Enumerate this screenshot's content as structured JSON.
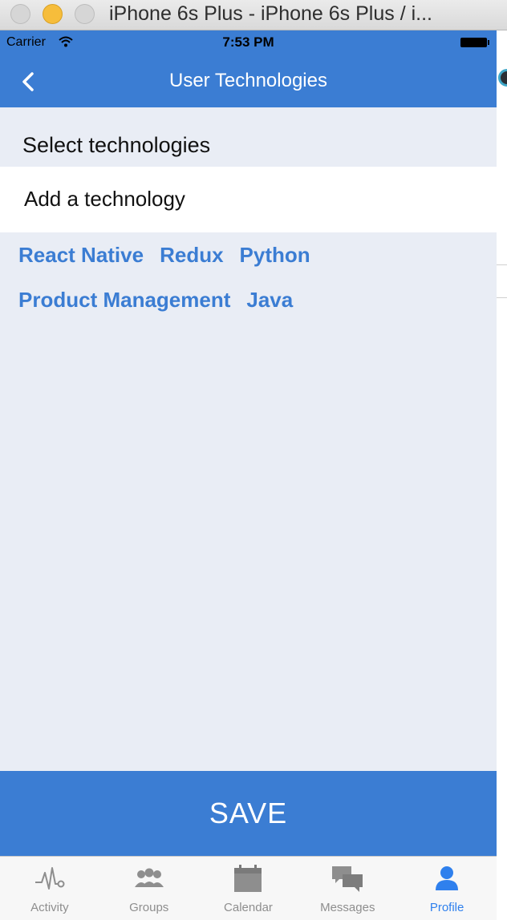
{
  "window": {
    "title": "iPhone 6s Plus - iPhone 6s Plus / i..."
  },
  "status_bar": {
    "carrier": "Carrier",
    "time": "7:53 PM"
  },
  "nav": {
    "title": "User Technologies"
  },
  "form": {
    "section_label": "Select technologies",
    "input_placeholder": "Add a technology"
  },
  "tags": [
    [
      "React Native",
      "Redux",
      "Python"
    ],
    [
      "Product Management",
      "Java"
    ]
  ],
  "save_label": "SAVE",
  "tab_bar": {
    "active": "Profile",
    "items": [
      {
        "label": "Activity",
        "icon": "activity-icon"
      },
      {
        "label": "Groups",
        "icon": "groups-icon"
      },
      {
        "label": "Calendar",
        "icon": "calendar-icon"
      },
      {
        "label": "Messages",
        "icon": "messages-icon"
      },
      {
        "label": "Profile",
        "icon": "profile-icon"
      }
    ]
  },
  "colors": {
    "primary": "#3b7dd3",
    "background": "#e9edf5",
    "tab_active": "#2f80ed",
    "tab_inactive": "#8e8e8e"
  }
}
